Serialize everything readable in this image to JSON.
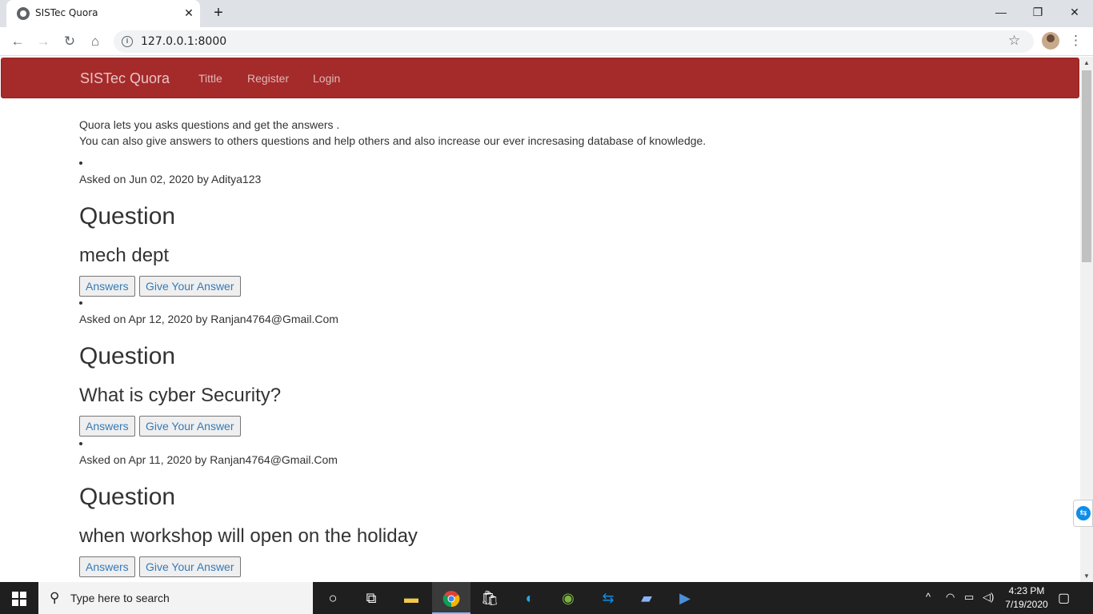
{
  "browser": {
    "tab_title": "SISTec Quora",
    "tab_close": "✕",
    "new_tab": "+",
    "url": "127.0.0.1:8000",
    "window_controls": {
      "minimize": "—",
      "restore": "❐",
      "close": "✕"
    },
    "nav_icons": {
      "back": "←",
      "forward": "→",
      "reload": "↻",
      "home": "⌂"
    }
  },
  "navbar": {
    "brand": "SISTec Quora",
    "links": [
      "Tittle",
      "Register",
      "Login"
    ],
    "color": "#a52a2a"
  },
  "intro": {
    "line1": "Quora lets you asks questions and get the answers .",
    "line2": "You can also give answers to others questions and help others and also increase our ever incresasing database of knowledge."
  },
  "questions": [
    {
      "meta": "Asked on Jun 02, 2020 by Aditya123",
      "heading": "Question",
      "text": "mech dept",
      "answers_label": "Answers",
      "give_answer_label": "Give Your Answer"
    },
    {
      "meta": "Asked on Apr 12, 2020 by Ranjan4764@Gmail.Com",
      "heading": "Question",
      "text": "What is cyber Security?",
      "answers_label": "Answers",
      "give_answer_label": "Give Your Answer"
    },
    {
      "meta": "Asked on Apr 11, 2020 by Ranjan4764@Gmail.Com",
      "heading": "Question",
      "text": "when workshop will open on the holiday",
      "answers_label": "Answers",
      "give_answer_label": "Give Your Answer"
    }
  ],
  "taskbar": {
    "search_placeholder": "Type here to search",
    "time": "4:23 PM",
    "date": "7/19/2020",
    "apps": [
      "cortana-icon",
      "task-view-icon",
      "file-explorer-icon",
      "chrome-icon",
      "store-icon",
      "edge-icon",
      "android-studio-icon",
      "teamviewer-icon",
      "notepad-icon",
      "powershell-icon"
    ]
  }
}
